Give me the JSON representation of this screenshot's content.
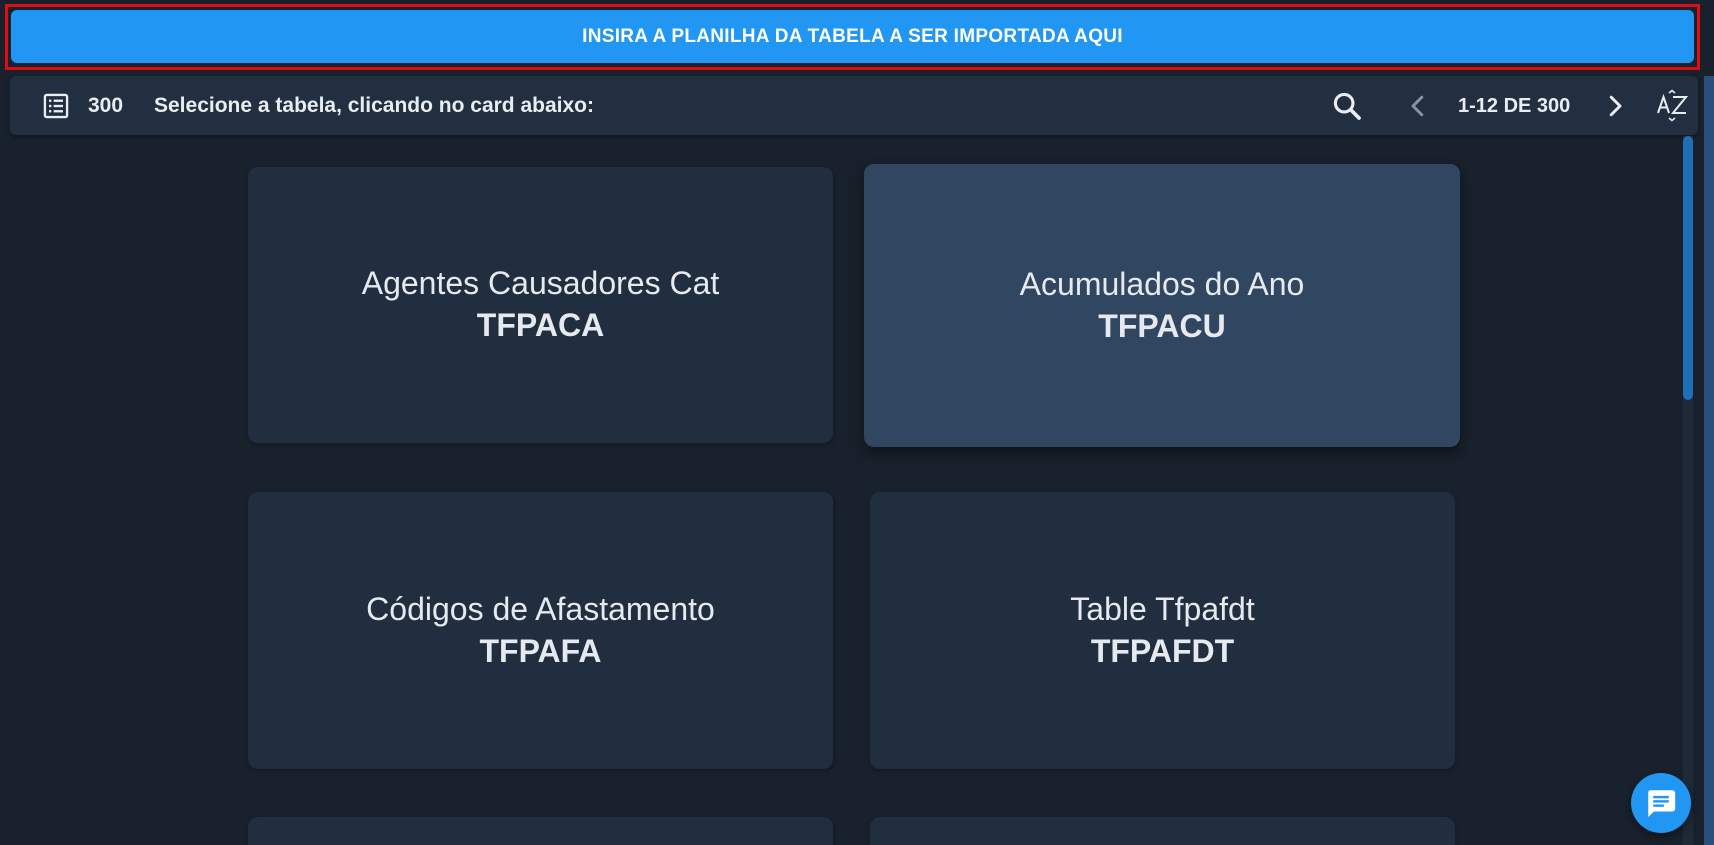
{
  "import_button": {
    "label": "INSIRA A PLANILHA DA TABELA A SER IMPORTADA AQUI",
    "highlight_color": "#e10d15",
    "color": "#2196f3"
  },
  "toolbar": {
    "list_icon": "list-icon",
    "total_count": "300",
    "instruction": "Selecione a tabela, clicando no card abaixo:",
    "search_icon": "search-icon",
    "prev_icon": "chevron-left-icon",
    "range": "1-12 DE 300",
    "next_icon": "chevron-right-icon",
    "sort_icon": "sort-az-icon"
  },
  "cards": [
    {
      "title": "Agentes Causadores Cat",
      "code": "TFPACA",
      "state": "default"
    },
    {
      "title": "Acumulados do Ano",
      "code": "TFPACU",
      "state": "hover"
    },
    {
      "title": "Códigos de Afastamento",
      "code": "TFPAFA",
      "state": "default"
    },
    {
      "title": "Table Tfpafdt",
      "code": "TFPAFDT",
      "state": "default"
    },
    {
      "title": "",
      "code": "",
      "state": "default"
    },
    {
      "title": "",
      "code": "",
      "state": "default"
    }
  ],
  "chat": {
    "icon": "chat-icon"
  },
  "colors": {
    "background": "#18212c",
    "card": "#202e3f",
    "card_hover": "#304661",
    "accent": "#2196f3"
  }
}
